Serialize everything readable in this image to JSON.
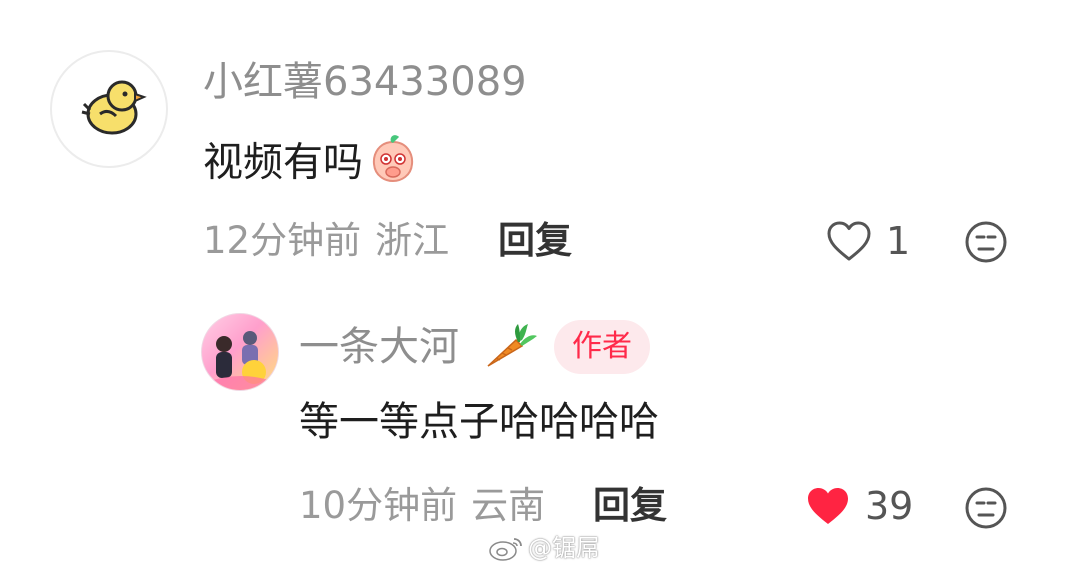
{
  "comments": [
    {
      "username": "小红薯63433089",
      "text": "视频有吗",
      "inline_emoji": "peach-shy-emoji",
      "time": "12分钟前",
      "location": "浙江",
      "reply_label": "回复",
      "like_count": "1",
      "liked": false
    },
    {
      "username": "一条大河",
      "name_emoji": "carrot-icon",
      "badge": "作者",
      "text": "等一等点子哈哈哈哈",
      "time": "10分钟前",
      "location": "云南",
      "reply_label": "回复",
      "like_count": "39",
      "liked": true
    }
  ],
  "colors": {
    "liked_heart": "#ff2442",
    "badge_text": "#ff2a4a",
    "badge_bg": "#fde9ec"
  },
  "watermark": "@锯屌"
}
